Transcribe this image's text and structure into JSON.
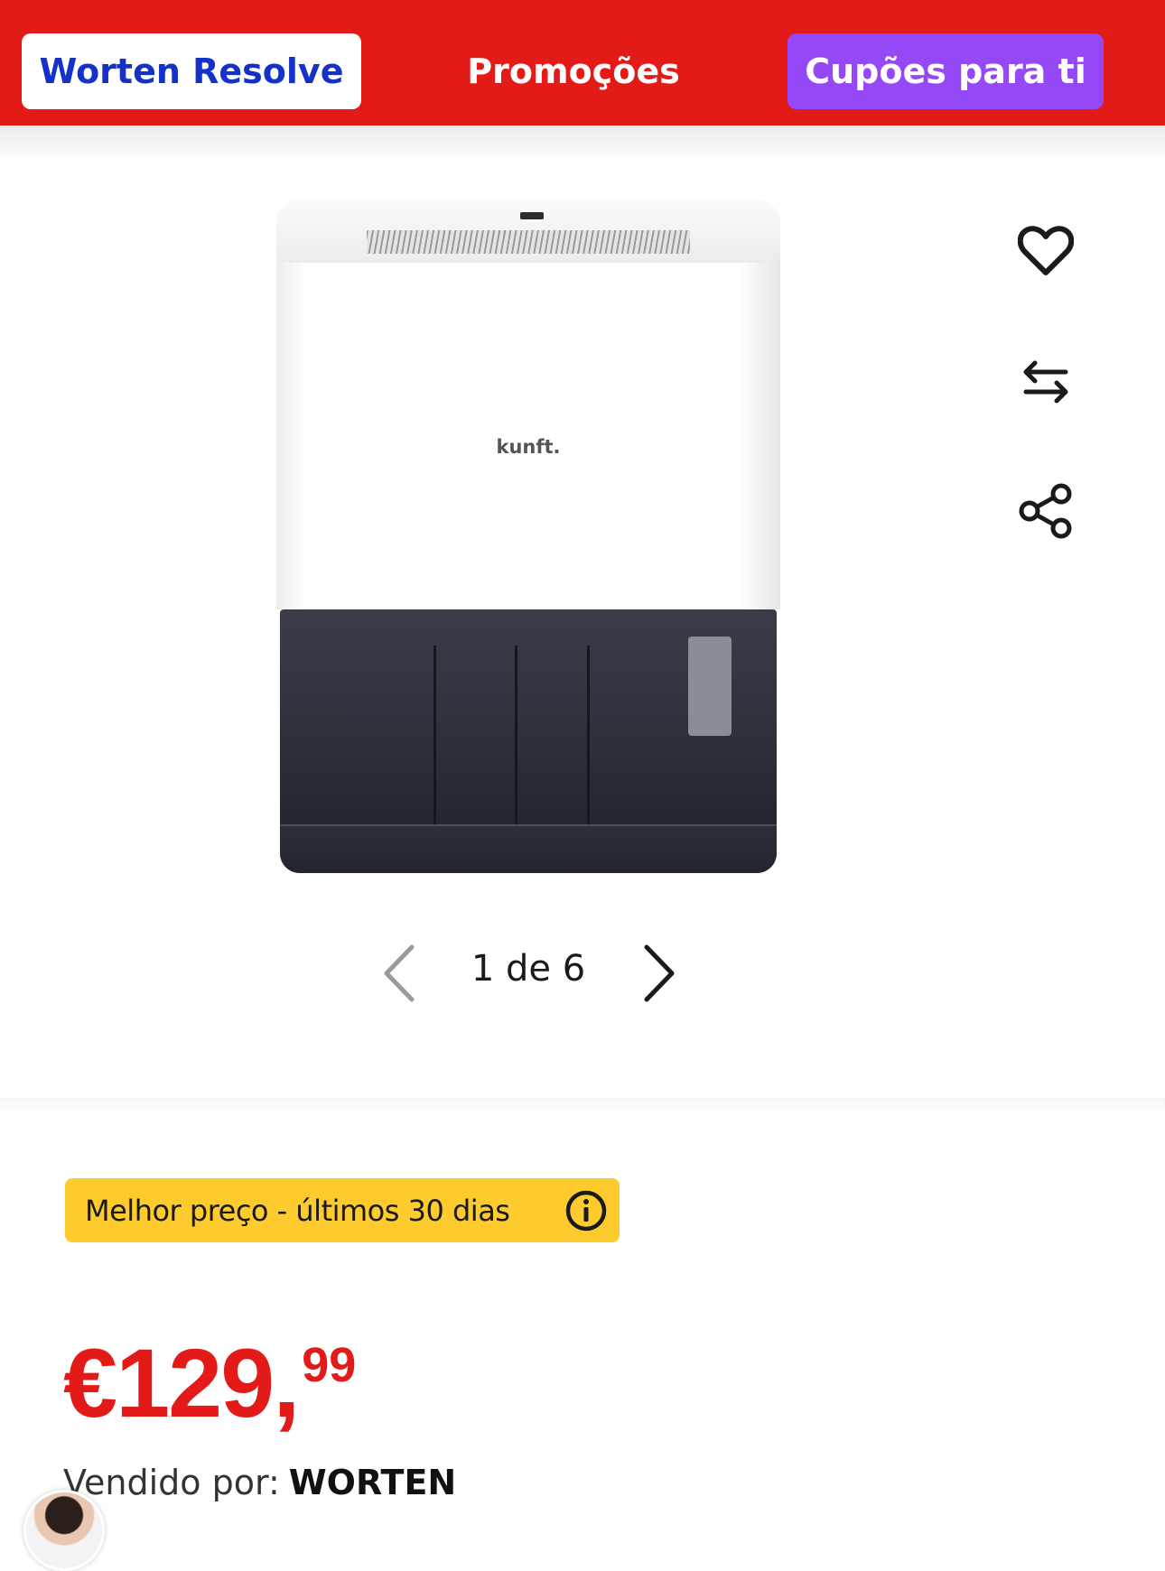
{
  "topbar": {
    "resolve_label": "Worten Resolve",
    "promo_label": "Promoções",
    "cupoes_label": "Cupões para ti",
    "colors": {
      "bar": "#e31b18",
      "resolve_text": "#1432c8",
      "cupoes_bg": "#9548f5"
    }
  },
  "product_image": {
    "brand_text": "kunft."
  },
  "actions": {
    "icons": [
      "heart-icon",
      "compare-arrows-icon",
      "share-icon"
    ]
  },
  "pager": {
    "counter": "1 de 6",
    "current": 1,
    "total": 6
  },
  "badge": {
    "text": "Melhor preço - últimos 30 dias",
    "color": "#fecb2f"
  },
  "price": {
    "main": "€129,",
    "cents": "99",
    "color": "#e31b18"
  },
  "seller": {
    "label": "Vendido por:",
    "name": "WORTEN"
  }
}
